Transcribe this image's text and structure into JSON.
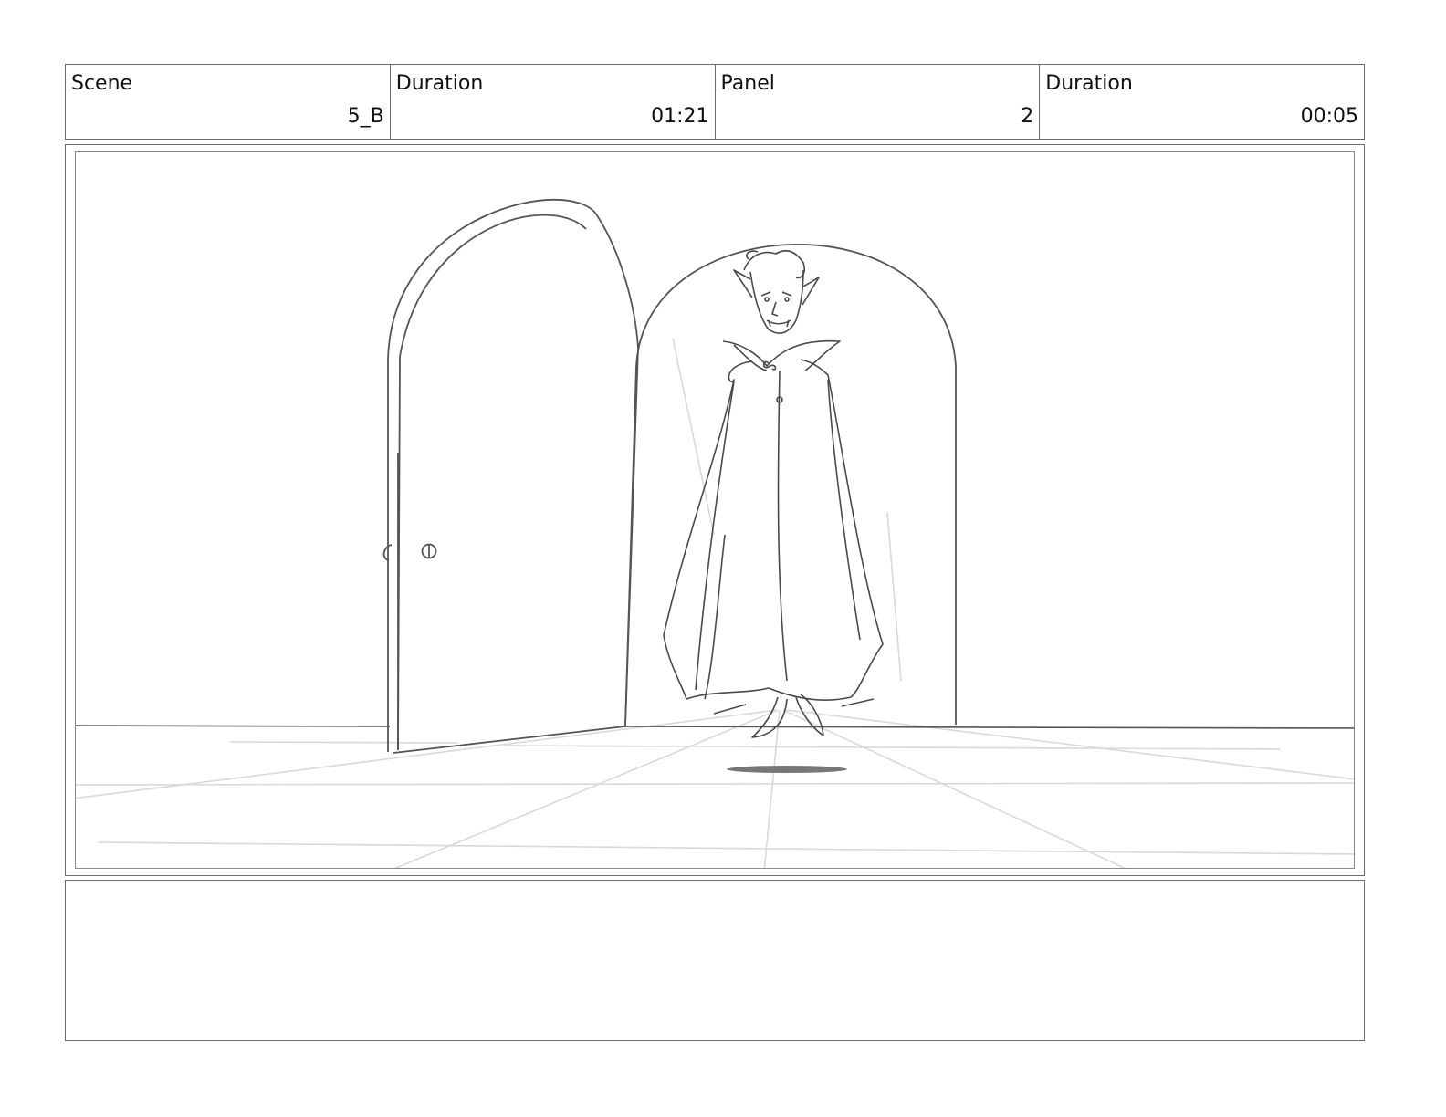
{
  "header": {
    "cells": [
      {
        "label": "Scene",
        "value": "5_B"
      },
      {
        "label": "Duration",
        "value": "01:21"
      },
      {
        "label": "Panel",
        "value": "2"
      },
      {
        "label": "Duration",
        "value": "00:05"
      }
    ]
  },
  "notes": {
    "text": ""
  },
  "colors": {
    "border": "#6b6b6b",
    "sketch": "#4a4a4a",
    "guide": "#d6d6d6"
  }
}
